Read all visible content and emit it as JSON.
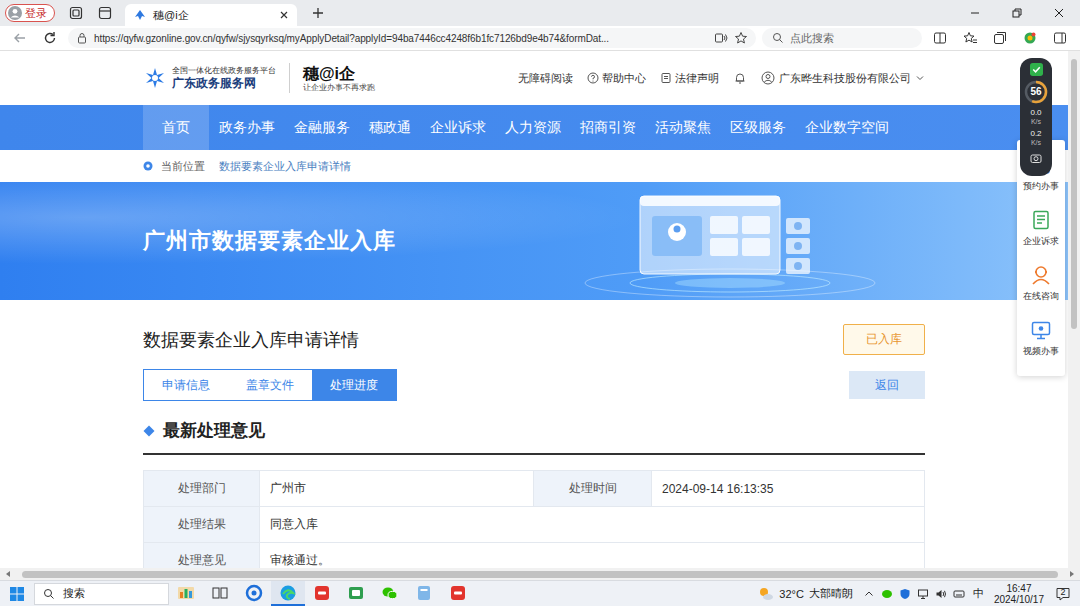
{
  "browser": {
    "profile": "登录",
    "tabs": [
      {
        "title": "穗@i企",
        "selected": true
      }
    ],
    "url": "https://qyfw.gzonline.gov.cn/qyfw/sjysqyrksq/myApplyDetail?applyId=94ba7446cc4248f6b1fc7126bd9e4b74&formDat...",
    "search": {
      "placeholder": "点此搜索"
    }
  },
  "site": {
    "logo": {
      "tagline": "全国一体化在线政务服务平台",
      "name": "广东政务服务网"
    },
    "brand": {
      "name": "穗@i企",
      "slogan": "让企业办事不再求跑"
    },
    "top_links": [
      {
        "label": "无障碍阅读",
        "kind": "plain"
      },
      {
        "label": "帮助中心",
        "kind": "help"
      },
      {
        "label": "法律声明",
        "kind": "doc"
      }
    ],
    "user": {
      "name": "广东晔生科技股份有限公司"
    },
    "nav": [
      {
        "label": "首页",
        "selected": true
      },
      {
        "label": "政务办事",
        "selected": false
      },
      {
        "label": "金融服务",
        "selected": false
      },
      {
        "label": "穗政通",
        "selected": false
      },
      {
        "label": "企业诉求",
        "selected": false
      },
      {
        "label": "人力资源",
        "selected": false
      },
      {
        "label": "招商引资",
        "selected": false
      },
      {
        "label": "活动聚焦",
        "selected": false
      },
      {
        "label": "区级服务",
        "selected": false
      },
      {
        "label": "企业数字空间",
        "selected": false
      }
    ],
    "breadcrumb": {
      "label": "当前位置",
      "current": "数据要素企业入库申请详情"
    },
    "banner": {
      "title": "广州市数据要素企业入库"
    },
    "detail": {
      "title": "数据要素企业入库申请详情",
      "status": "已入库",
      "tabs": [
        {
          "label": "申请信息",
          "selected": false
        },
        {
          "label": "盖章文件",
          "selected": false
        },
        {
          "label": "处理进度",
          "selected": true
        }
      ],
      "back": "返回",
      "section": "最新处理意见",
      "rows": [
        {
          "fields": [
            {
              "label": "处理部门",
              "value": "广州市"
            },
            {
              "label": "处理时间",
              "value": "2024-09-14 16:13:35"
            }
          ]
        },
        {
          "fields": [
            {
              "label": "处理结果",
              "value": "同意入库"
            }
          ]
        },
        {
          "fields": [
            {
              "label": "处理意见",
              "value": "审核通过。"
            }
          ]
        }
      ]
    }
  },
  "float_panel": {
    "items": [
      {
        "label": "预约办事",
        "kind": "calendar"
      },
      {
        "label": "企业诉求",
        "kind": "appeal"
      },
      {
        "label": "在线咨询",
        "kind": "consult"
      },
      {
        "label": "视频办事",
        "kind": "video"
      }
    ]
  },
  "monitor": {
    "percent": "56",
    "level": 0.56,
    "rates": [
      {
        "value": "0.0",
        "unit": "K/s"
      },
      {
        "value": "0.2",
        "unit": "K/s"
      }
    ]
  },
  "taskbar": {
    "search": "搜索",
    "apps": [
      {
        "kind": "photos",
        "active": false
      },
      {
        "kind": "taskview",
        "active": false
      },
      {
        "kind": "browser",
        "active": false
      },
      {
        "kind": "edge",
        "active": true
      },
      {
        "kind": "wps",
        "active": false
      },
      {
        "kind": "files",
        "active": false
      },
      {
        "kind": "wechat",
        "active": false
      },
      {
        "kind": "app",
        "active": false
      },
      {
        "kind": "wps",
        "active": false
      }
    ],
    "weather": {
      "temp": "32°C",
      "text": "大部晴朗"
    },
    "ime": "中",
    "time": "16:47",
    "date": "2024/10/17",
    "notifications": "2"
  }
}
